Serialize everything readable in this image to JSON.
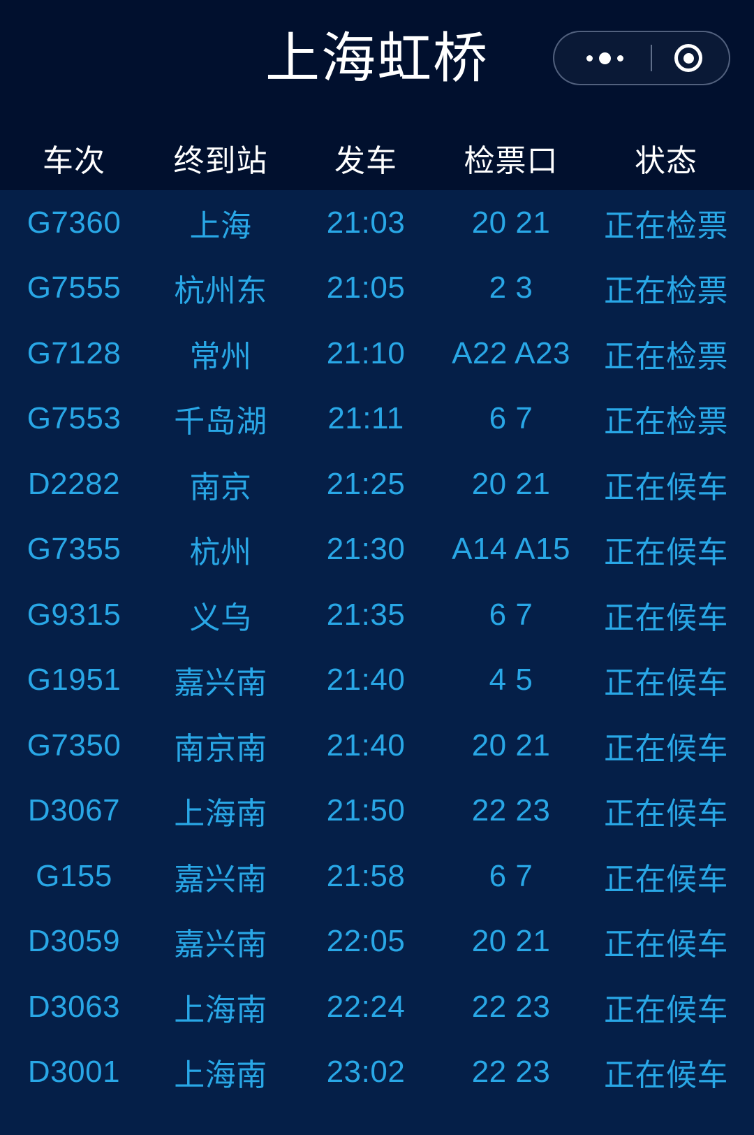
{
  "app": {
    "station_title": "上海虹桥",
    "background_header": "#01102e",
    "background_board": "#051f48",
    "accent_text": "#29a7e6",
    "header_text": "#ffffff"
  },
  "capsule": {
    "more_icon": "more-dots-icon",
    "target_icon": "target-circle-icon"
  },
  "columns": {
    "train": "车次",
    "destination": "终到站",
    "departure": "发车",
    "gate": "检票口",
    "status": "状态"
  },
  "rows": [
    {
      "train": "G7360",
      "destination": "上海",
      "departure": "21:03",
      "gate": "20 21",
      "status": "正在检票"
    },
    {
      "train": "G7555",
      "destination": "杭州东",
      "departure": "21:05",
      "gate": "2 3",
      "status": "正在检票"
    },
    {
      "train": "G7128",
      "destination": "常州",
      "departure": "21:10",
      "gate": "A22 A23",
      "status": "正在检票"
    },
    {
      "train": "G7553",
      "destination": "千岛湖",
      "departure": "21:11",
      "gate": "6 7",
      "status": "正在检票"
    },
    {
      "train": "D2282",
      "destination": "南京",
      "departure": "21:25",
      "gate": "20 21",
      "status": "正在候车"
    },
    {
      "train": "G7355",
      "destination": "杭州",
      "departure": "21:30",
      "gate": "A14 A15",
      "status": "正在候车"
    },
    {
      "train": "G9315",
      "destination": "义乌",
      "departure": "21:35",
      "gate": "6 7",
      "status": "正在候车"
    },
    {
      "train": "G1951",
      "destination": "嘉兴南",
      "departure": "21:40",
      "gate": "4 5",
      "status": "正在候车"
    },
    {
      "train": "G7350",
      "destination": "南京南",
      "departure": "21:40",
      "gate": "20 21",
      "status": "正在候车"
    },
    {
      "train": "D3067",
      "destination": "上海南",
      "departure": "21:50",
      "gate": "22 23",
      "status": "正在候车"
    },
    {
      "train": "G155",
      "destination": "嘉兴南",
      "departure": "21:58",
      "gate": "6 7",
      "status": "正在候车"
    },
    {
      "train": "D3059",
      "destination": "嘉兴南",
      "departure": "22:05",
      "gate": "20 21",
      "status": "正在候车"
    },
    {
      "train": "D3063",
      "destination": "上海南",
      "departure": "22:24",
      "gate": "22 23",
      "status": "正在候车"
    },
    {
      "train": "D3001",
      "destination": "上海南",
      "departure": "23:02",
      "gate": "22 23",
      "status": "正在候车"
    }
  ]
}
